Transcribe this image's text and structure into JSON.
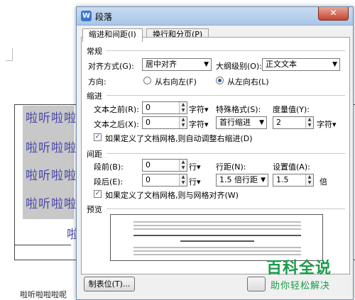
{
  "document": {
    "lines": [
      "啦听啦啦",
      "啦听啦啦",
      "啦听啦啦",
      "啦听啦啦",
      "啦"
    ],
    "bottom_text": "啦听啦啦啦呢"
  },
  "dialog": {
    "title": "段落",
    "close_symbol": "✕",
    "tabs": [
      "缩进和间距(I)",
      "换行和分页(P)"
    ],
    "general": {
      "section": "常规",
      "alignment_label": "对齐方式(G):",
      "alignment_value": "居中对齐",
      "outline_label": "大纲级别(O):",
      "outline_value": "正文文本",
      "direction_label": "方向:",
      "rtl_label": "从右向左(F)",
      "ltr_label": "从左向右(L)"
    },
    "indent": {
      "section": "缩进",
      "before_label": "文本之前(R):",
      "before_value": "0",
      "before_unit": "字符▾",
      "special_label": "特殊格式(S):",
      "measure_label": "度量值(Y):",
      "after_label": "文本之后(X):",
      "after_value": "0",
      "after_unit": "字符▾",
      "special_value": "首行缩进",
      "measure_value": "2",
      "measure_unit": "字符▾",
      "grid_check_label": "如果定义了文档网格,则自动调整右缩进(D)"
    },
    "spacing": {
      "section": "间距",
      "before_label": "段前(B):",
      "before_value": "0",
      "before_unit": "行▾",
      "line_spacing_label": "行距(N):",
      "set_value_label": "设置值(A):",
      "after_label": "段后(E):",
      "after_value": "0",
      "after_unit": "行▾",
      "line_spacing_value": "1.5 倍行距",
      "set_value": "1.5",
      "set_value_unit": "倍",
      "grid_check_label": "如果定义了文档网格,则与网格对齐(W)"
    },
    "preview_label": "预览",
    "tabs_button": "制表位(T)..."
  },
  "watermark": {
    "title": "百科全说",
    "subtitle": "助你轻松解决"
  },
  "colors": {
    "doc_text": "#4a48a8",
    "titlebar": "#a9c6e8",
    "close_button": "#c7462f",
    "watermark": "#1a9b4c"
  },
  "icons": {
    "app": "wps-writer-icon",
    "close": "close-icon",
    "dropdown": "chevron-down-icon"
  }
}
